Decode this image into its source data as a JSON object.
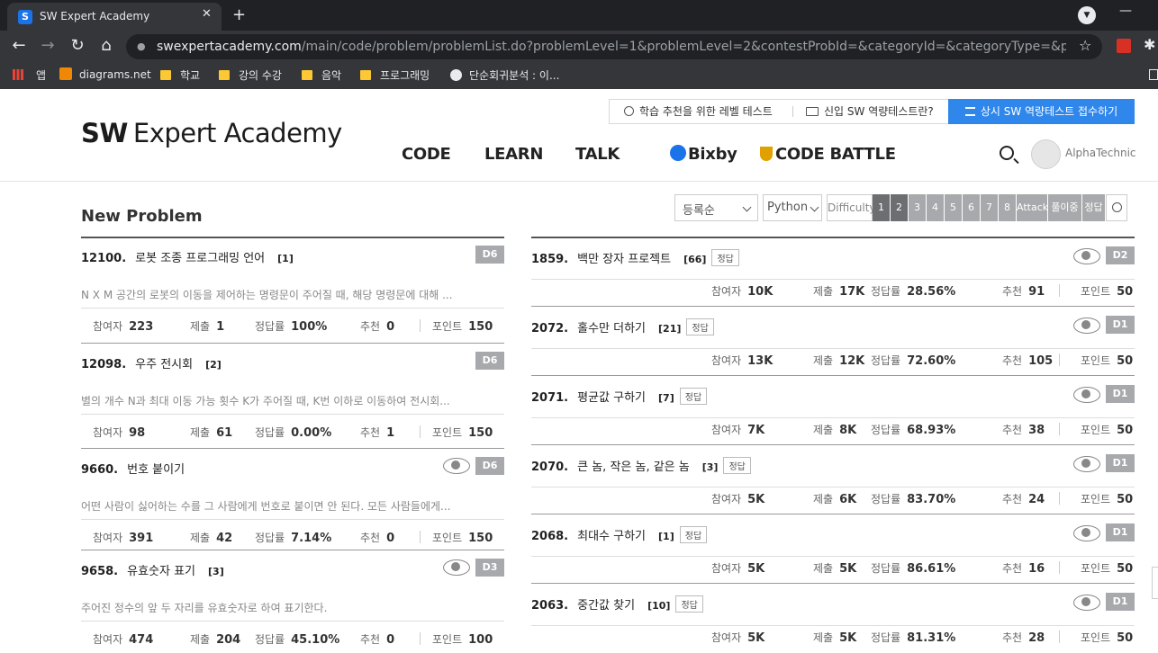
{
  "browser": {
    "tab_title": "SW Expert Academy",
    "tab_favicon": "S",
    "close_icon": "✕",
    "newtab_icon": "+",
    "url_host": "swexpertacademy.com",
    "url_path": "/main/code/problem/problemList.do?problemLevel=1&problemLevel=2&contestProbId=&categoryId=&categoryType=&problemTitle...",
    "bookmarks": {
      "apps": "앱",
      "diagrams": "diagrams.net",
      "school": "학교",
      "lecture": "강의 수강",
      "music": "음악",
      "programming": "프로그래밍",
      "regression": "단순회귀분석 : 이..."
    }
  },
  "header": {
    "logo_bold": "SW",
    "logo_rest": "Expert Academy",
    "level_test": "학습 추천을 위한 레벨 테스트",
    "new_sw": "신입 SW 역량테스트란?",
    "apply": "상시 SW 역량테스트 접수하기",
    "menu": {
      "code": "CODE",
      "learn": "LEARN",
      "talk": "TALK",
      "bixby": "Bixby",
      "battle": "CODE BATTLE"
    },
    "username": "AlphaTechnic"
  },
  "filter": {
    "title": "New Problem",
    "sort": "등록순",
    "lang": "Python",
    "difficulty": "Difficulty",
    "levels": [
      "1",
      "2",
      "3",
      "4",
      "5",
      "6",
      "7",
      "8"
    ],
    "selected_levels": [
      "1",
      "2"
    ],
    "attack": "Attack",
    "pending": "풀이중",
    "correct": "정답"
  },
  "labels": {
    "participants": "참여자",
    "submissions": "제출",
    "accuracy": "정답률",
    "recommend": "추천",
    "points": "포인트",
    "correct_badge": "정답"
  },
  "left": [
    {
      "num": "12100.",
      "title": "로봇 조종 프로그래밍 언어",
      "count": "[1]",
      "level": "D6",
      "eye": false,
      "desc": "N X M 공간의 로봇의 이동을 제어하는 명령문이 주어질 때, 해당 명령문에 대해 ...",
      "participants": "223",
      "submissions": "1",
      "accuracy": "100%",
      "recommend": "0",
      "points": "150"
    },
    {
      "num": "12098.",
      "title": "우주 전시회",
      "count": "[2]",
      "level": "D6",
      "eye": false,
      "desc": "별의 개수 N과 최대 이동 가능 횟수 K가 주어질 때, K번 이하로 이동하여 전시회...",
      "participants": "98",
      "submissions": "61",
      "accuracy": "0.00%",
      "recommend": "1",
      "points": "150"
    },
    {
      "num": "9660.",
      "title": "번호 붙이기",
      "count": "",
      "level": "D6",
      "eye": true,
      "desc": "어떤 사람이 싫어하는 수를 그 사람에게 번호로 붙이면 안 된다. 모든 사람들에게...",
      "participants": "391",
      "submissions": "42",
      "accuracy": "7.14%",
      "recommend": "0",
      "points": "150"
    },
    {
      "num": "9658.",
      "title": "유효숫자 표기",
      "count": "[3]",
      "level": "D3",
      "eye": true,
      "desc": "주어진 정수의 앞 두 자리를 유효숫자로 하여 표기한다.",
      "participants": "474",
      "submissions": "204",
      "accuracy": "45.10%",
      "recommend": "0",
      "points": "100"
    }
  ],
  "right": [
    {
      "num": "1859.",
      "title": "백만 장자 프로젝트",
      "count": "[66]",
      "level": "D2",
      "participants": "10K",
      "submissions": "17K",
      "accuracy": "28.56%",
      "recommend": "91",
      "points": "50"
    },
    {
      "num": "2072.",
      "title": "홀수만 더하기",
      "count": "[21]",
      "level": "D1",
      "participants": "13K",
      "submissions": "12K",
      "accuracy": "72.60%",
      "recommend": "105",
      "points": "50"
    },
    {
      "num": "2071.",
      "title": "평균값 구하기",
      "count": "[7]",
      "level": "D1",
      "participants": "7K",
      "submissions": "8K",
      "accuracy": "68.93%",
      "recommend": "38",
      "points": "50"
    },
    {
      "num": "2070.",
      "title": "큰 놈, 작은 놈, 같은 놈",
      "count": "[3]",
      "level": "D1",
      "participants": "5K",
      "submissions": "6K",
      "accuracy": "83.70%",
      "recommend": "24",
      "points": "50"
    },
    {
      "num": "2068.",
      "title": "최대수 구하기",
      "count": "[1]",
      "level": "D1",
      "participants": "5K",
      "submissions": "5K",
      "accuracy": "86.61%",
      "recommend": "16",
      "points": "50"
    },
    {
      "num": "2063.",
      "title": "중간값 찾기",
      "count": "[10]",
      "level": "D1",
      "participants": "5K",
      "submissions": "5K",
      "accuracy": "81.31%",
      "recommend": "28",
      "points": "50"
    }
  ]
}
